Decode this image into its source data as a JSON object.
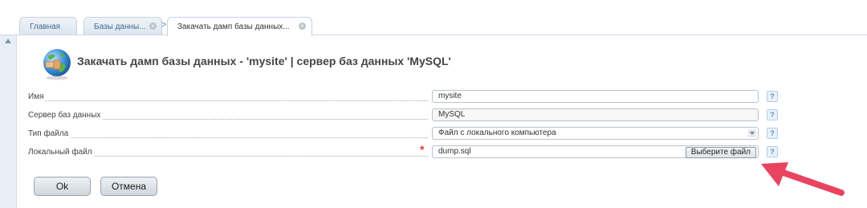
{
  "tabs": {
    "home": "Главная",
    "databases": "Базы данны...",
    "upload_dump": "Закачать дамп базы данных..."
  },
  "page_title": "Закачать дамп базы данных - 'mysite' | сервер баз данных 'MySQL'",
  "form": {
    "name": {
      "label": "Имя",
      "value": "mysite"
    },
    "server": {
      "label": "Сервер баз данных",
      "value": "MySQL"
    },
    "file_type": {
      "label": "Тип файла",
      "value": "Файл с локального компьютера"
    },
    "local_file": {
      "label": "Локальный файл",
      "value": "dump.sql",
      "browse_label": "Выберите файл",
      "required_mark": "*"
    },
    "help_glyph": "?"
  },
  "buttons": {
    "ok": "Ok",
    "cancel": "Отмена"
  },
  "icons": {
    "title": "globe-upload-icon",
    "close": "close-icon",
    "help": "help-icon",
    "arrow": "red-arrow-annotation"
  },
  "colors": {
    "accent": "#466a8f",
    "required": "#e23b3b",
    "annotation_arrow": "#e8445f"
  }
}
